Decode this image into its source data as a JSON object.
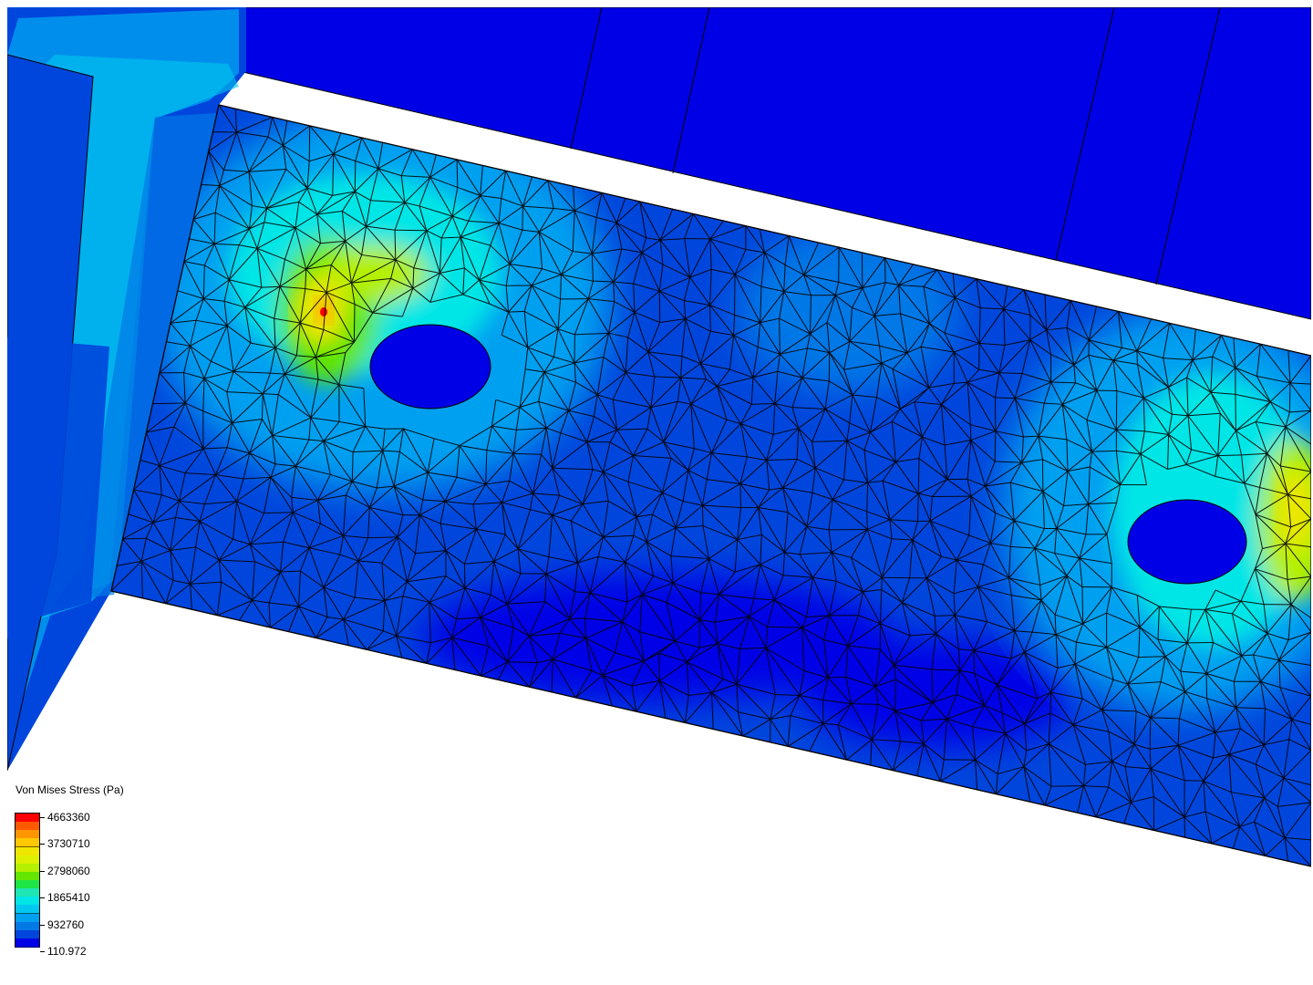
{
  "viewer": {
    "result_field": "Von Mises Stress",
    "interaction": "rotate / pan / zoom"
  },
  "legend": {
    "title": "Von Mises Stress (Pa)",
    "ticks": [
      "4663360",
      "3730710",
      "2798060",
      "1865410",
      "932760",
      "110.972"
    ],
    "min_value": 110.972,
    "max_value": 4663360,
    "levels": 16,
    "colors": [
      "#ff0000",
      "#ff5a00",
      "#ff9600",
      "#ffc800",
      "#f0e600",
      "#dcf000",
      "#b4f000",
      "#64e600",
      "#1ee646",
      "#1ee6b4",
      "#00e6e6",
      "#00c8f0",
      "#00a0f0",
      "#0078e6",
      "#0046dc",
      "#0000e6"
    ]
  },
  "colors": {
    "background": "#ffffff",
    "mesh_lines": "#000000",
    "min_stress": "#0000e6",
    "max_stress": "#ff0000"
  }
}
